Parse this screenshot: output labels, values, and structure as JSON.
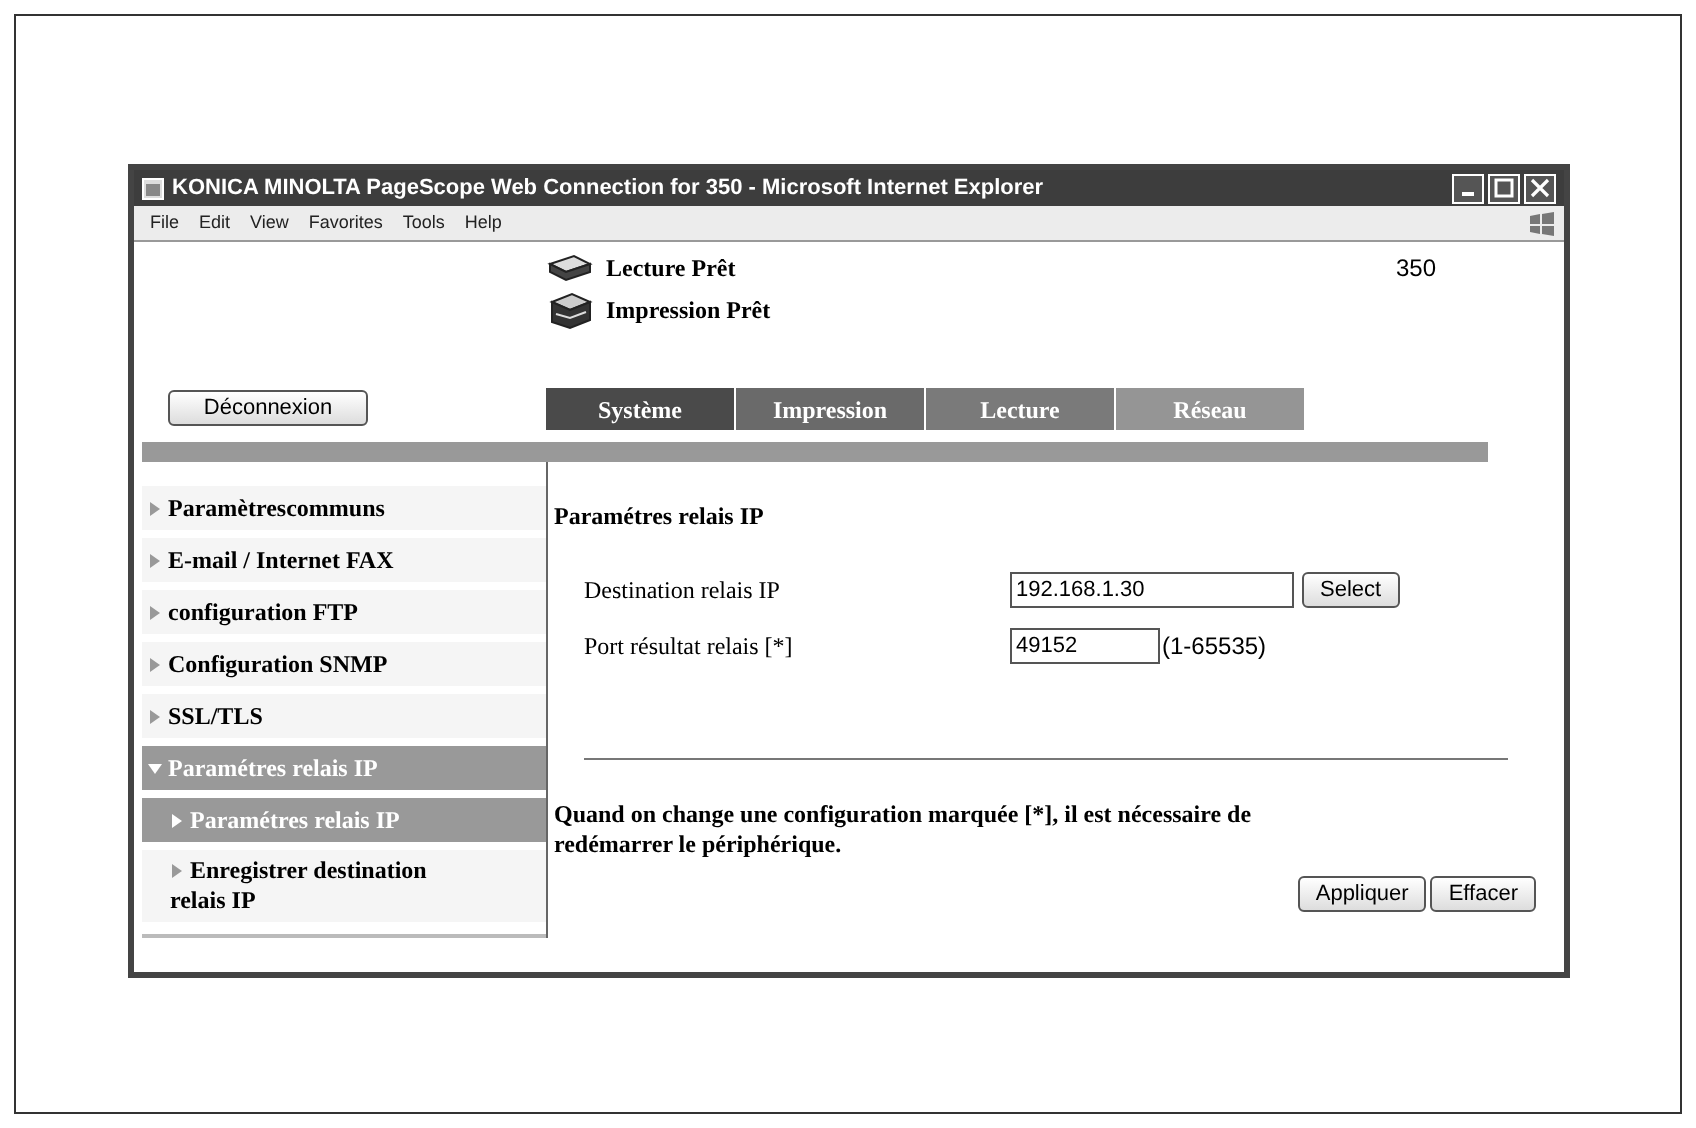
{
  "window": {
    "title": "KONICA MINOLTA PageScope Web Connection for 350 - Microsoft Internet Explorer"
  },
  "menu": [
    "File",
    "Edit",
    "View",
    "Favorites",
    "Tools",
    "Help"
  ],
  "status": [
    {
      "kind": "scanner",
      "label": "Lecture Prêt"
    },
    {
      "kind": "printer",
      "label": "Impression Prêt"
    }
  ],
  "model": "350",
  "logout_button": "Déconnexion",
  "tabs": [
    {
      "label": "Système",
      "color": "#4a4a4a"
    },
    {
      "label": "Impression",
      "color": "#6a6a6a"
    },
    {
      "label": "Lecture",
      "color": "#7a7a7a"
    },
    {
      "label": "Réseau",
      "color": "#959595"
    }
  ],
  "sidebar": {
    "items": [
      {
        "label": "Paramètrescommuns",
        "selected": false
      },
      {
        "label": "E-mail / Internet FAX",
        "selected": false
      },
      {
        "label": "configuration FTP",
        "selected": false
      },
      {
        "label": "Configuration SNMP",
        "selected": false
      },
      {
        "label": "SSL/TLS",
        "selected": false
      },
      {
        "label": "Paramétres relais IP",
        "selected": true,
        "expanded": true,
        "children": [
          {
            "label": "Paramétres relais IP",
            "selected": true
          },
          {
            "label": "Enregistrer destination relais IP",
            "selected": false
          }
        ]
      }
    ]
  },
  "form": {
    "title": "Paramétres relais IP",
    "fields": [
      {
        "kind": "select",
        "label": "Destination relais IP",
        "value": "192.168.1.30",
        "button": "Select"
      },
      {
        "kind": "range",
        "label": "Port résultat relais [*]",
        "value": "49152",
        "hint": "(1-65535)"
      }
    ],
    "note": "Quand on change une configuration marquée [*], il est nécessaire de redémarrer le périphérique.",
    "buttons": [
      "Appliquer",
      "Effacer"
    ]
  }
}
